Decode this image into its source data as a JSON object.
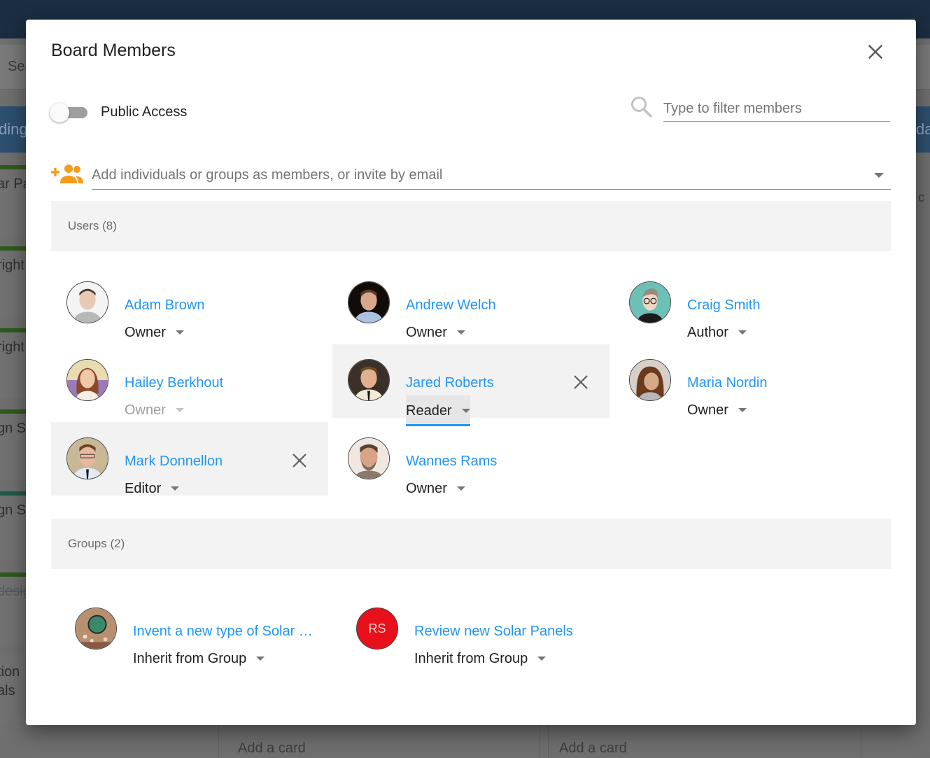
{
  "background": {
    "search_fragment": "Sea",
    "column_fragments": [
      "dings",
      "day"
    ],
    "card_fragments": [
      "ar Pa",
      "right",
      "right",
      "gn S",
      "gn S",
      "desig",
      "tion",
      "als"
    ],
    "right_fragment": "c",
    "add_card_label": "Add a card"
  },
  "modal": {
    "title": "Board Members",
    "close_icon": "close-icon",
    "public_access": {
      "label": "Public Access",
      "enabled": false
    },
    "filter": {
      "placeholder": "Type to filter members",
      "value": "",
      "icon": "search-icon"
    },
    "add_members": {
      "placeholder": "Add individuals or groups as members, or invite by email",
      "icon": "add-group-icon",
      "accent": "#f59c1a"
    },
    "users_section": {
      "label": "Users (8)"
    },
    "users": [
      {
        "name": "Adam Brown",
        "role": "Owner",
        "role_disabled": false
      },
      {
        "name": "Andrew Welch",
        "role": "Owner",
        "role_disabled": false
      },
      {
        "name": "Craig Smith",
        "role": "Author",
        "role_disabled": false
      },
      {
        "name": "Hailey Berkhout",
        "role": "Owner",
        "role_disabled": true
      },
      {
        "name": "Jared Roberts",
        "role": "Reader",
        "role_disabled": false,
        "hovered": true,
        "role_focused": true
      },
      {
        "name": "Maria Nordin",
        "role": "Owner",
        "role_disabled": false
      },
      {
        "name": "Mark Donnellon",
        "role": "Editor",
        "role_disabled": false,
        "hovered": true
      },
      {
        "name": "Wannes Rams",
        "role": "Owner",
        "role_disabled": false
      }
    ],
    "groups_section": {
      "label": "Groups (2)"
    },
    "groups": [
      {
        "name": "Invent a new type of Solar …",
        "role": "Inherit from Group"
      },
      {
        "name": "Review new Solar Panels",
        "role": "Inherit from Group",
        "initials": "RS",
        "avatar_color": "#e8101b"
      }
    ],
    "link_color": "#2196f3"
  }
}
